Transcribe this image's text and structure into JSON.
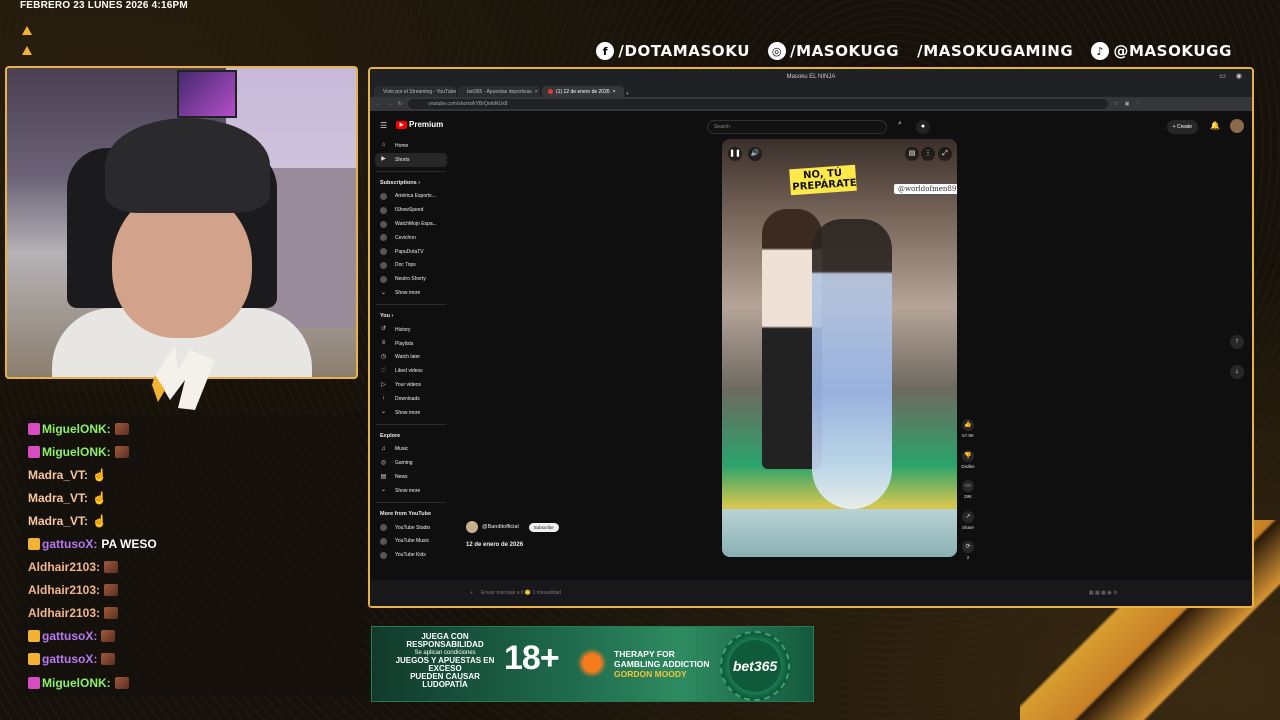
{
  "datetime": "FEBRERO 23 LUNES 2026 4:16PM",
  "socials": [
    {
      "icon": "facebook-icon",
      "glyph": "f",
      "label": "/DOTAMASOKU"
    },
    {
      "icon": "instagram-icon",
      "glyph": "◎",
      "label": "/MASOKUGG"
    },
    {
      "icon": "youtube-icon",
      "glyph": "▶",
      "label": "/MASOKUGAMING"
    },
    {
      "icon": "tiktok-icon",
      "glyph": "♪",
      "label": "@MASOKUGG"
    }
  ],
  "chat": [
    {
      "user": "MiguelONK:",
      "color": "#8ef06a",
      "badge_color": "#d84cc2",
      "text": "",
      "emote": true
    },
    {
      "user": "MiguelONK:",
      "color": "#8ef06a",
      "badge_color": "#d84cc2",
      "text": "",
      "emote": true
    },
    {
      "user": "Madra_VT:",
      "color": "#f5c6a0",
      "badge_color": "",
      "text": "☝",
      "emote": false
    },
    {
      "user": "Madra_VT:",
      "color": "#f5c6a0",
      "badge_color": "",
      "text": "☝",
      "emote": false
    },
    {
      "user": "Madra_VT:",
      "color": "#f5c6a0",
      "badge_color": "",
      "text": "☝",
      "emote": false
    },
    {
      "user": "gattusoX:",
      "color": "#b779f0",
      "badge_color": "#f2b233",
      "text": "PA WESO",
      "emote": false
    },
    {
      "user": "Aldhair2103:",
      "color": "#f3b58c",
      "badge_color": "",
      "text": "",
      "emote": true
    },
    {
      "user": "Aldhair2103:",
      "color": "#f3b58c",
      "badge_color": "",
      "text": "",
      "emote": true
    },
    {
      "user": "Aldhair2103:",
      "color": "#f3b58c",
      "badge_color": "",
      "text": "",
      "emote": true
    },
    {
      "user": "gattusoX:",
      "color": "#b779f0",
      "badge_color": "#f2b233",
      "text": "",
      "emote": true
    },
    {
      "user": "gattusoX:",
      "color": "#b779f0",
      "badge_color": "#f2b233",
      "text": "",
      "emote": true
    },
    {
      "user": "MiguelONK:",
      "color": "#8ef06a",
      "badge_color": "#d84cc2",
      "text": "",
      "emote": true
    }
  ],
  "browser": {
    "window_title": "Masoku EL NINJA",
    "tabs": [
      {
        "label": "Visto por el Streaming - YouTube",
        "active": false,
        "favicon": "youtube"
      },
      {
        "label": "bet365 - Apuestas deportivas",
        "active": false,
        "favicon": "bet365"
      },
      {
        "label": "(1) 12 de enero de 2026",
        "active": true,
        "favicon": "youtube"
      }
    ],
    "url": "youtube.com/shorts/kYBrQmbNUx8"
  },
  "youtube": {
    "brand": "Premium",
    "search_placeholder": "Search",
    "create_label": "Create",
    "sidebar": {
      "main": [
        {
          "icon": "home-icon",
          "glyph": "⌂",
          "label": "Home",
          "active": false
        },
        {
          "icon": "shorts-icon",
          "glyph": "▶",
          "label": "Shorts",
          "active": true
        }
      ],
      "subscriptions_title": "Subscriptions",
      "subscriptions": [
        {
          "label": "América Esports..."
        },
        {
          "label": "IShowSpeed"
        },
        {
          "label": "WatchMojo Espa..."
        },
        {
          "label": "Cevichon"
        },
        {
          "label": "PapuDotaTV"
        },
        {
          "label": "Doc Tops"
        },
        {
          "label": "Neutro Shorty"
        },
        {
          "label": "Show more"
        }
      ],
      "you_title": "You",
      "you": [
        {
          "glyph": "↺",
          "label": "History"
        },
        {
          "glyph": "≡",
          "label": "Playlists"
        },
        {
          "glyph": "◷",
          "label": "Watch later"
        },
        {
          "glyph": "♡",
          "label": "Liked videos"
        },
        {
          "glyph": "▷",
          "label": "Your videos"
        },
        {
          "glyph": "↓",
          "label": "Downloads"
        },
        {
          "glyph": "⌄",
          "label": "Show more"
        }
      ],
      "explore_title": "Explore",
      "explore": [
        {
          "glyph": "♫",
          "label": "Music"
        },
        {
          "glyph": "◎",
          "label": "Gaming"
        },
        {
          "glyph": "▤",
          "label": "News"
        },
        {
          "glyph": "⌄",
          "label": "Show more"
        }
      ],
      "more_title": "More from YouTube",
      "more": [
        {
          "label": "YouTube Studio"
        },
        {
          "label": "YouTube Music"
        },
        {
          "label": "YouTube Kids"
        }
      ]
    },
    "short": {
      "caption": "NO, TÚ PREPÁRATE",
      "handle": "@worldofmen89",
      "channel": "@Banditofficial",
      "subscribe": "Subscribe",
      "date": "12 de enero de 2026"
    },
    "actions": [
      {
        "icon": "like-icon",
        "glyph": "👍",
        "label": "67.8K"
      },
      {
        "icon": "dislike-icon",
        "glyph": "👎",
        "label": "Dislike"
      },
      {
        "icon": "comment-icon",
        "glyph": "▭",
        "label": "28K"
      },
      {
        "icon": "share-icon",
        "glyph": "↗",
        "label": "Share"
      },
      {
        "icon": "remix-icon",
        "glyph": "⟳",
        "label": "2"
      }
    ],
    "chat_input": "Enviar mensaje a tl 🙂 1 mesadidad"
  },
  "promo": {
    "line1": "JUEGA CON RESPONSABILIDAD",
    "line2": "Se aplican condiciones",
    "line3": "JUEGOS Y APUESTAS EN EXCESO",
    "line4": "PUEDEN CAUSAR LUDOPATÍA",
    "age": "18+",
    "therapy1": "THERAPY FOR",
    "therapy2": "GAMBLING ADDICTION",
    "therapy3": "GORDON MOODY",
    "brand": "bet365"
  }
}
